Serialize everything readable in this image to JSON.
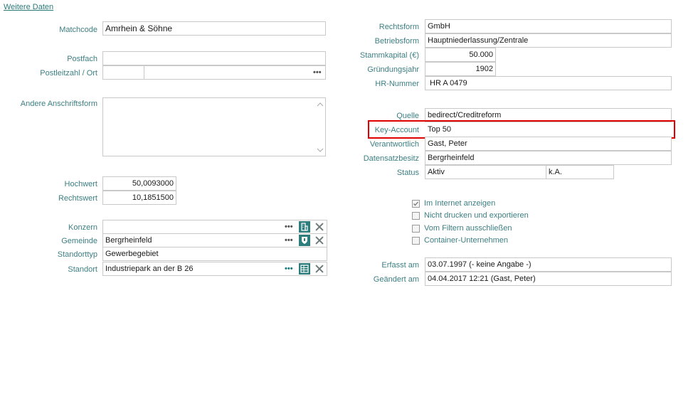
{
  "header": {
    "link": "Weitere Daten"
  },
  "left": {
    "matchcode": {
      "label": "Matchcode",
      "value": "Amrhein & Söhne"
    },
    "postfach": {
      "label": "Postfach",
      "value": ""
    },
    "plz_ort": {
      "label": "Postleitzahl / Ort",
      "plz": "",
      "ort": ""
    },
    "andere": {
      "label": "Andere Anschriftsform",
      "value": ""
    },
    "hochwert": {
      "label": "Hochwert",
      "value": "50,0093000"
    },
    "rechtswert": {
      "label": "Rechtswert",
      "value": "10,1851500"
    },
    "konzern": {
      "label": "Konzern",
      "value": ""
    },
    "gemeinde": {
      "label": "Gemeinde",
      "value": "Bergrheinfeld"
    },
    "standorttyp": {
      "label": "Standorttyp",
      "value": "Gewerbegebiet"
    },
    "standort": {
      "label": "Standort",
      "value": "Industriepark an der B 26"
    },
    "dots": "•••"
  },
  "right": {
    "rechtsform": {
      "label": "Rechtsform",
      "value": "GmbH"
    },
    "betriebsform": {
      "label": "Betriebsform",
      "value": "Hauptniederlassung/Zentrale"
    },
    "stammkapital": {
      "label": "Stammkapital (€)",
      "value": "50.000"
    },
    "gruendungsjahr": {
      "label": "Gründungsjahr",
      "value": "1902"
    },
    "hr_nummer": {
      "label": "HR-Nummer",
      "value": "HR A 0479"
    },
    "quelle": {
      "label": "Quelle",
      "value": "bedirect/Creditreform"
    },
    "key_account": {
      "label": "Key-Account",
      "value": "Top 50"
    },
    "verantwortlich": {
      "label": "Verantwortlich",
      "value": "Gast, Peter"
    },
    "datensatzbesitz": {
      "label": "Datensatzbesitz",
      "value": "Bergrheinfeld"
    },
    "status": {
      "label": "Status",
      "value": "Aktiv",
      "value2": "k.A."
    },
    "checkboxes": [
      {
        "label": "Im Internet anzeigen",
        "checked": true
      },
      {
        "label": "Nicht drucken und exportieren",
        "checked": false
      },
      {
        "label": "Vom Filtern ausschließen",
        "checked": false
      },
      {
        "label": "Container-Unternehmen",
        "checked": false
      }
    ],
    "erfasst": {
      "label": "Erfasst am",
      "value": "03.07.1997 (- keine Angabe -)"
    },
    "geaendert": {
      "label": "Geändert am",
      "value": "04.04.2017 12:21 (Gast, Peter)"
    }
  },
  "colors": {
    "label": "#3d7f82",
    "accent": "#2e7d7d",
    "highlight": "#e00000"
  }
}
